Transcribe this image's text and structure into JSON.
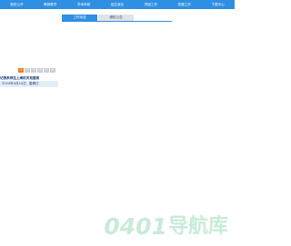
{
  "nav": {
    "items": [
      "首页公开",
      "教育教学",
      "学术科研",
      "招生就业",
      "学团工作",
      "党建工作",
      "下载中心"
    ]
  },
  "tabs": {
    "items": [
      "工作动态",
      "通知公告"
    ],
    "active_index": 0
  },
  "pager": {
    "pages": [
      "1",
      "2",
      "3",
      "4",
      "5",
      "6"
    ],
    "active_index": 0
  },
  "news": {
    "title": "记我系师生上海机关党建观",
    "date": "2024年4月14日",
    "weekday": "星期日"
  },
  "watermark": {
    "digits": "0401",
    "text": "导航库"
  },
  "colors": {
    "nav_bg": "#2f8fe3",
    "pager_active": "#f07d1d",
    "watermark": "#c8ebd9"
  }
}
